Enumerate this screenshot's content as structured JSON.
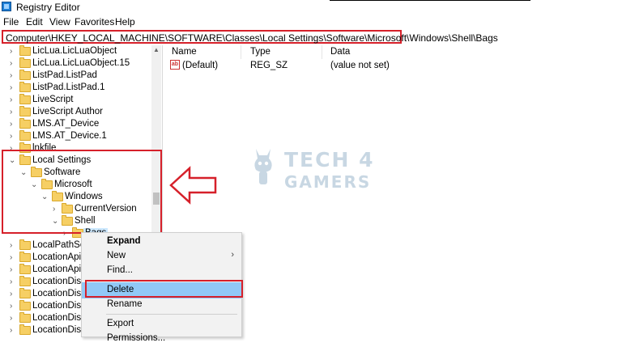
{
  "window": {
    "title": "Registry Editor"
  },
  "menu": [
    "File",
    "Edit",
    "View",
    "Favorites",
    "Help"
  ],
  "address": {
    "path": "Computer\\HKEY_LOCAL_MACHINE\\SOFTWARE\\Classes\\Local Settings\\Software\\Microsoft\\Windows\\Shell\\Bags"
  },
  "tree": [
    {
      "label": "LicLua.LicLuaObject"
    },
    {
      "label": "LicLua.LicLuaObject.15"
    },
    {
      "label": "ListPad.ListPad"
    },
    {
      "label": "ListPad.ListPad.1"
    },
    {
      "label": "LiveScript"
    },
    {
      "label": "LiveScript Author"
    },
    {
      "label": "LMS.AT_Device"
    },
    {
      "label": "LMS.AT_Device.1"
    },
    {
      "label": "lnkfile"
    },
    {
      "label": "Local Settings"
    },
    {
      "label": "Software"
    },
    {
      "label": "Microsoft"
    },
    {
      "label": "Windows"
    },
    {
      "label": "CurrentVersion"
    },
    {
      "label": "Shell"
    },
    {
      "label": "Bags"
    },
    {
      "label": "LocalPathSearch"
    },
    {
      "label": "LocationApi"
    },
    {
      "label": "LocationApi.1"
    },
    {
      "label": "LocationDisp.C"
    },
    {
      "label": "LocationDisp.C"
    },
    {
      "label": "LocationDisp.D"
    },
    {
      "label": "LocationDisp.D"
    },
    {
      "label": "LocationDisp.D"
    },
    {
      "label": "LocationDisp.D"
    }
  ],
  "list": {
    "headers": {
      "name": "Name",
      "type": "Type",
      "data": "Data"
    },
    "rows": [
      {
        "name": "(Default)",
        "type": "REG_SZ",
        "data": "(value not set)"
      }
    ]
  },
  "watermark": {
    "line1": "TECH 4",
    "line2": "GAMERS"
  },
  "context_menu": {
    "items": [
      {
        "label": "Expand"
      },
      {
        "label": "New"
      },
      {
        "label": "Find..."
      },
      {
        "label": "Delete"
      },
      {
        "label": "Rename"
      },
      {
        "label": "Export"
      },
      {
        "label": "Permissions..."
      }
    ]
  },
  "colors": {
    "highlight_red": "#d6202a",
    "selection_blue": "#91c9f7",
    "folder_yellow": "#f6cf64"
  }
}
